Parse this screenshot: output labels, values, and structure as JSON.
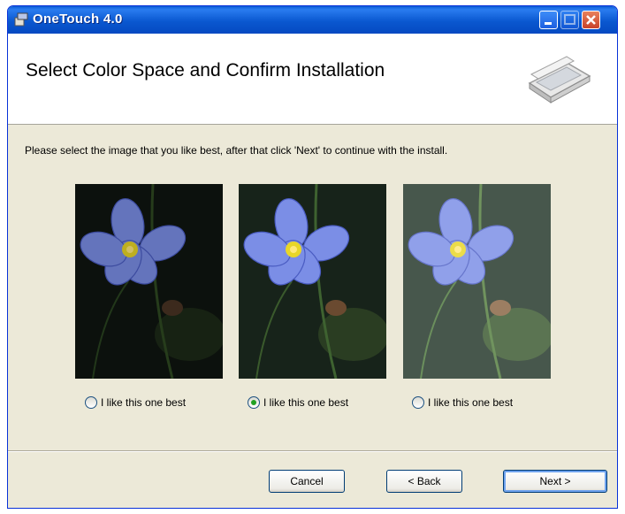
{
  "window": {
    "title": "OneTouch 4.0"
  },
  "header": {
    "title": "Select Color Space and Confirm Installation"
  },
  "content": {
    "instructions": "Please select the image that you like best, after that click 'Next' to continue with the install.",
    "options": [
      {
        "label": "I like this one best",
        "selected": false
      },
      {
        "label": "I like this one best",
        "selected": true
      },
      {
        "label": "I like this one best",
        "selected": false
      }
    ]
  },
  "buttons": {
    "cancel": "Cancel",
    "back": "< Back",
    "next": "Next >"
  },
  "colors": {
    "titlebar": "#0a58d0",
    "dialog_background": "#ece9d8",
    "selected_radio": "#21a121"
  }
}
